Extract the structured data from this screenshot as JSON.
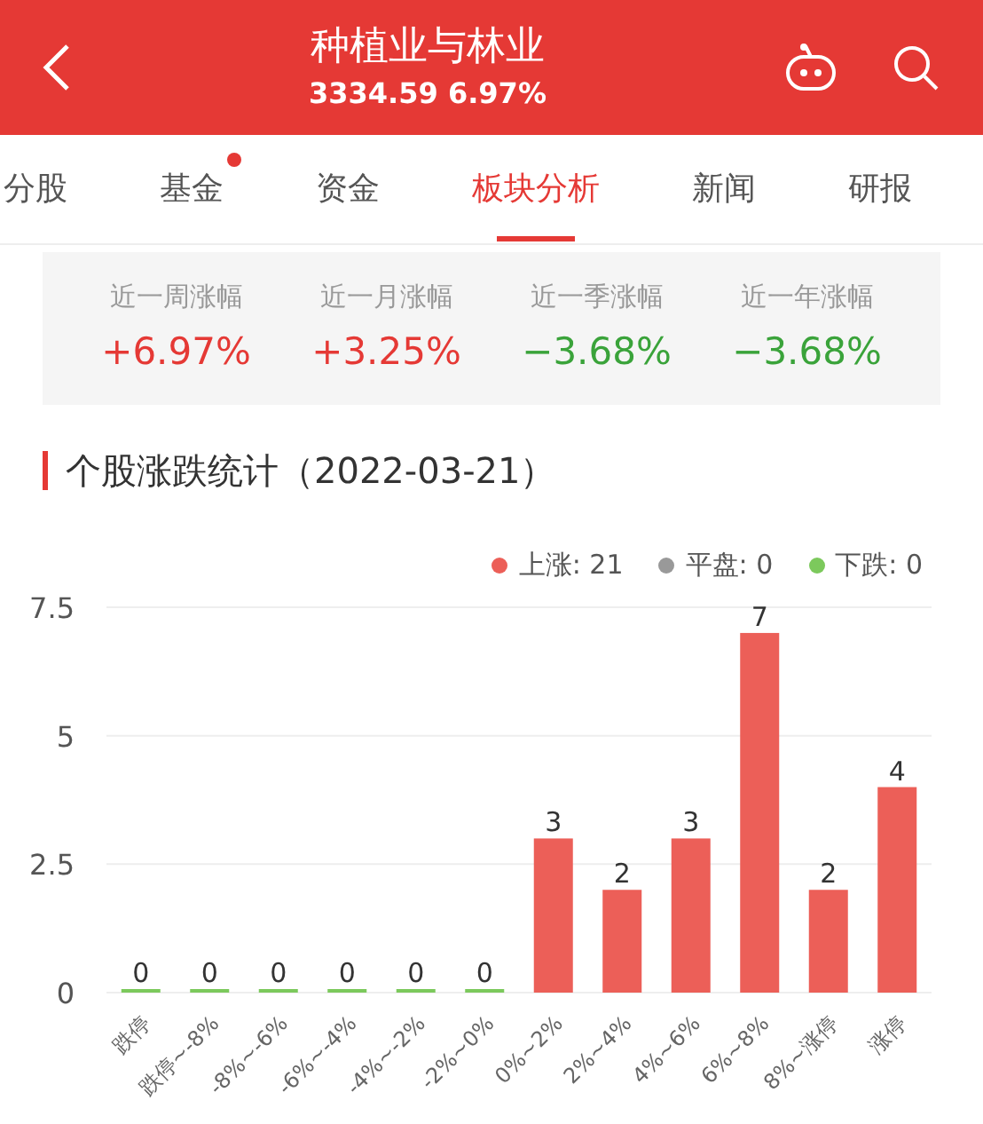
{
  "header": {
    "title": "种植业与林业",
    "subtitle": "3334.59 6.97%"
  },
  "tabs": [
    {
      "label": "分股",
      "selected": false,
      "dot": false
    },
    {
      "label": "基金",
      "selected": false,
      "dot": true
    },
    {
      "label": "资金",
      "selected": false,
      "dot": false
    },
    {
      "label": "板块分析",
      "selected": true,
      "dot": false
    },
    {
      "label": "新闻",
      "selected": false,
      "dot": false
    },
    {
      "label": "研报",
      "selected": false,
      "dot": false
    }
  ],
  "stats": [
    {
      "label": "近一周涨幅",
      "value": "+6.97%",
      "color": "#e53935"
    },
    {
      "label": "近一月涨幅",
      "value": "+3.25%",
      "color": "#e53935"
    },
    {
      "label": "近一季涨幅",
      "value": "−3.68%",
      "color": "#3aa33a"
    },
    {
      "label": "近一年涨幅",
      "value": "−3.68%",
      "color": "#3aa33a"
    }
  ],
  "section_title": "个股涨跌统计（2022-03-21）",
  "legend": [
    {
      "label": "上涨: 21",
      "color": "#ec5f58"
    },
    {
      "label": "平盘: 0",
      "color": "#999999"
    },
    {
      "label": "下跌: 0",
      "color": "#7cc95c"
    }
  ],
  "chart_data": {
    "type": "bar",
    "categories": [
      "跌停",
      "跌停~-8%",
      "-8%~-6%",
      "-6%~-4%",
      "-4%~-2%",
      "-2%~0%",
      "0%~2%",
      "2%~4%",
      "4%~6%",
      "6%~8%",
      "8%~涨停",
      "涨停"
    ],
    "series": [
      {
        "color": "#7cc95c",
        "values": [
          0,
          0,
          0,
          0,
          0,
          0,
          null,
          null,
          null,
          null,
          null,
          null
        ]
      },
      {
        "color": "#ec5f58",
        "values": [
          null,
          null,
          null,
          null,
          null,
          null,
          3,
          2,
          3,
          7,
          2,
          4
        ]
      }
    ],
    "ylim": [
      0,
      7.5
    ],
    "yticks": [
      0,
      2.5,
      5,
      7.5
    ],
    "data_labels": true
  }
}
